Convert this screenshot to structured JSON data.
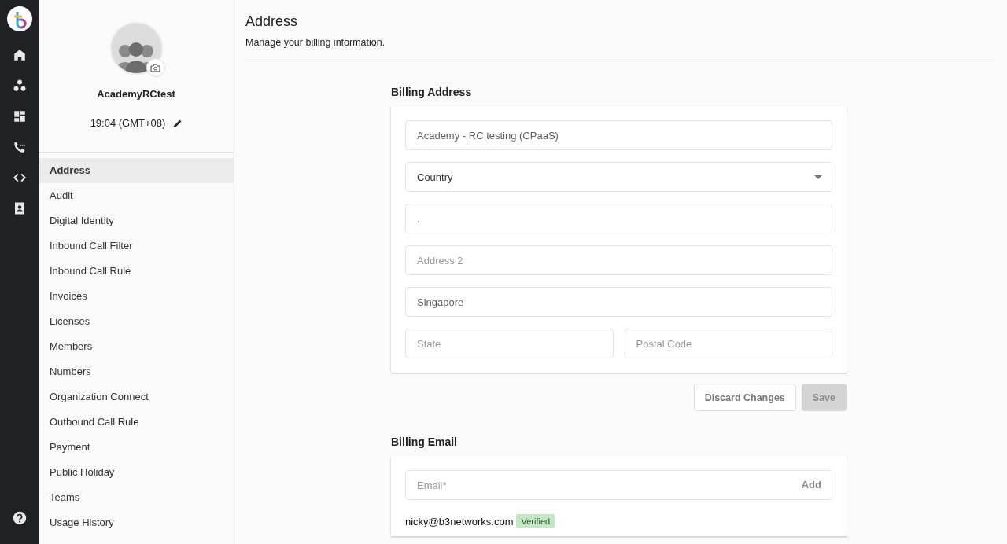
{
  "rail": {
    "items": [
      {
        "kind": "home",
        "selected": false
      },
      {
        "kind": "groups",
        "selected": false
      },
      {
        "kind": "dashboard",
        "selected": false
      },
      {
        "kind": "phone",
        "selected": false
      },
      {
        "kind": "code",
        "selected": false
      },
      {
        "kind": "contacts",
        "selected": false
      }
    ]
  },
  "profile": {
    "name": "AcademyRCtest",
    "time": "19:04 (GMT+08)"
  },
  "sidebar": {
    "items": [
      {
        "label": "Address",
        "selected": true
      },
      {
        "label": "Audit",
        "selected": false
      },
      {
        "label": "Digital Identity",
        "selected": false
      },
      {
        "label": "Inbound Call Filter",
        "selected": false
      },
      {
        "label": "Inbound Call Rule",
        "selected": false
      },
      {
        "label": "Invoices",
        "selected": false
      },
      {
        "label": "Licenses",
        "selected": false
      },
      {
        "label": "Members",
        "selected": false
      },
      {
        "label": "Numbers",
        "selected": false
      },
      {
        "label": "Organization Connect",
        "selected": false
      },
      {
        "label": "Outbound Call Rule",
        "selected": false
      },
      {
        "label": "Payment",
        "selected": false
      },
      {
        "label": "Public Holiday",
        "selected": false
      },
      {
        "label": "Teams",
        "selected": false
      },
      {
        "label": "Usage History",
        "selected": false
      }
    ]
  },
  "page": {
    "title": "Address",
    "subtitle": "Manage your billing information."
  },
  "billing_address": {
    "title": "Billing Address",
    "fields": [
      {
        "kind": "input",
        "value": "Academy - RC testing (CPaaS)"
      },
      {
        "kind": "select",
        "value": "Country"
      },
      {
        "kind": "input",
        "value": "."
      },
      {
        "kind": "input",
        "placeholder": "Address 2"
      },
      {
        "kind": "input",
        "value": "Singapore"
      },
      {
        "kind": "pair",
        "fields": [
          {
            "placeholder": "State"
          },
          {
            "placeholder": "Postal Code"
          }
        ]
      }
    ],
    "buttons": [
      {
        "label": "Discard Changes",
        "kind": "outline",
        "disabled": false
      },
      {
        "label": "Save",
        "kind": "filled",
        "disabled": true
      }
    ]
  },
  "billing_email": {
    "title": "Billing Email",
    "field": {
      "placeholder": "Email*",
      "action": "Add"
    },
    "emails": [
      {
        "address": "nicky@b3networks.com",
        "badge": "Verified"
      }
    ]
  }
}
